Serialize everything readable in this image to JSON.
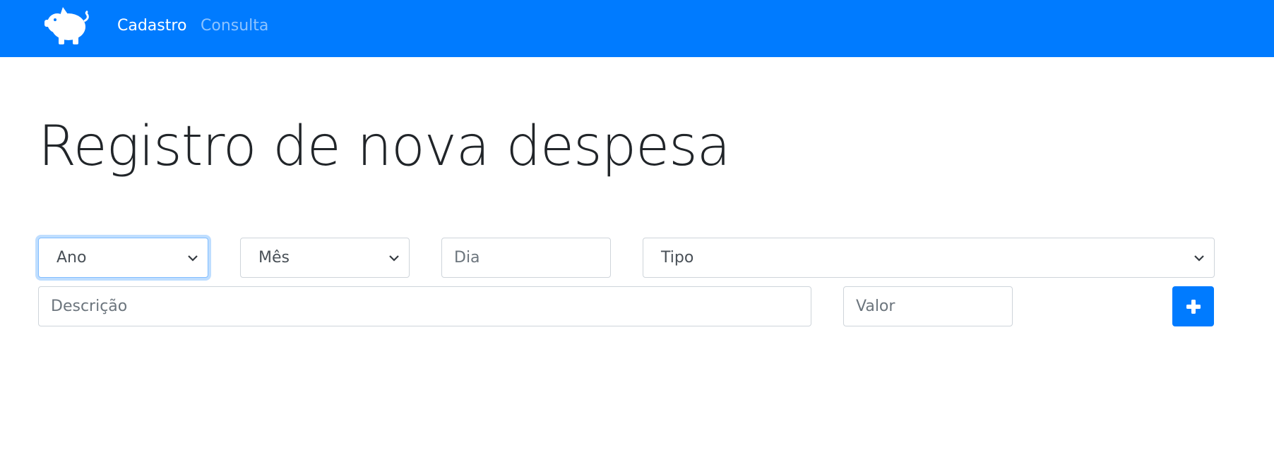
{
  "navbar": {
    "logo_icon": "piggy-bank-icon",
    "links": [
      {
        "label": "Cadastro",
        "active": true
      },
      {
        "label": "Consulta",
        "active": false
      }
    ],
    "background": "#007bff"
  },
  "main": {
    "title": "Registro de nova despesa"
  },
  "form": {
    "ano": {
      "value": "Ano",
      "focused": true
    },
    "mes": {
      "value": "Mês"
    },
    "dia": {
      "placeholder": "Dia",
      "value": ""
    },
    "tipo": {
      "value": "Tipo"
    },
    "descricao": {
      "placeholder": "Descrição",
      "value": ""
    },
    "valor": {
      "placeholder": "Valor",
      "value": ""
    },
    "add_button": {
      "icon": "plus-icon"
    }
  },
  "colors": {
    "primary": "#007bff",
    "focus_border": "#80bdff",
    "input_border": "#ced4da",
    "text": "#212529"
  }
}
